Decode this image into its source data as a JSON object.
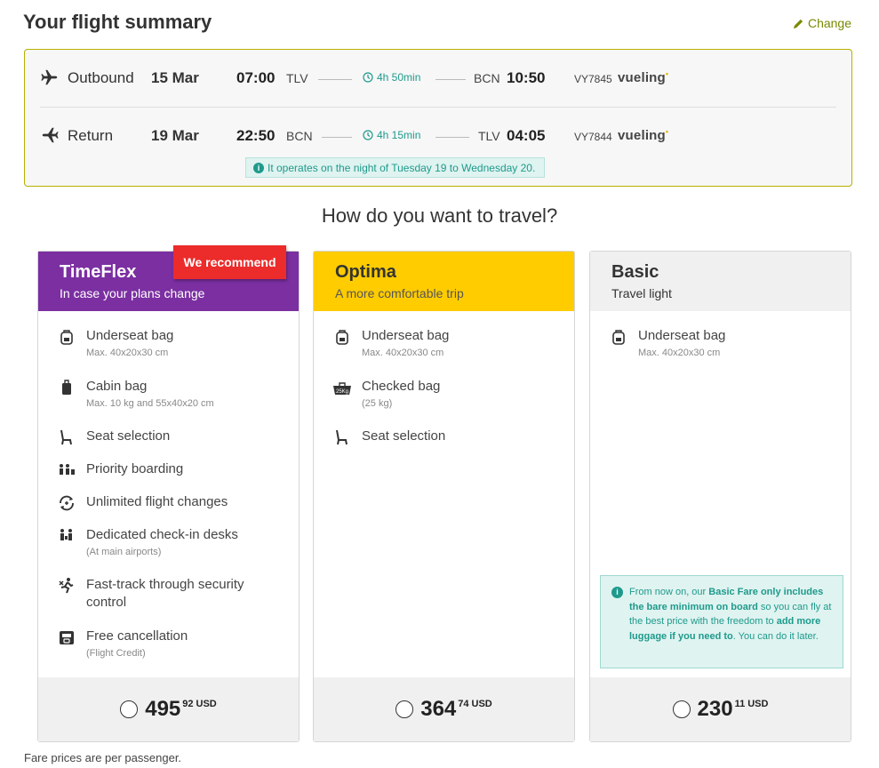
{
  "header": {
    "title": "Your flight summary",
    "change_label": "Change"
  },
  "flights": {
    "outbound": {
      "direction": "Outbound",
      "date": "15 Mar",
      "depart_time": "07:00",
      "depart_code": "TLV",
      "duration": "4h 50min",
      "arrive_code": "BCN",
      "arrive_time": "10:50",
      "flight_no": "VY7845",
      "airline": "vueling"
    },
    "return": {
      "direction": "Return",
      "date": "19 Mar",
      "depart_time": "22:50",
      "depart_code": "BCN",
      "duration": "4h 15min",
      "arrive_code": "TLV",
      "arrive_time": "04:05",
      "flight_no": "VY7844",
      "airline": "vueling"
    },
    "night_note": "It operates on the night of Tuesday 19 to Wednesday 20."
  },
  "question": "How do you want to travel?",
  "fares": [
    {
      "name": "TimeFlex",
      "subtitle": "In case your plans change",
      "badge": "We recommend",
      "features": [
        {
          "icon": "backpack-icon",
          "label": "Underseat bag",
          "detail": "Max. 40x20x30 cm"
        },
        {
          "icon": "suitcase-icon",
          "label": "Cabin bag",
          "detail": "Max. 10 kg and 55x40x20 cm"
        },
        {
          "icon": "seat-icon",
          "label": "Seat selection",
          "detail": ""
        },
        {
          "icon": "priority-boarding-icon",
          "label": "Priority boarding",
          "detail": ""
        },
        {
          "icon": "flight-changes-icon",
          "label": "Unlimited flight changes",
          "detail": ""
        },
        {
          "icon": "check-in-desk-icon",
          "label": "Dedicated check-in desks",
          "detail": "(At main airports)"
        },
        {
          "icon": "fast-track-icon",
          "label": "Fast-track through security control",
          "detail": ""
        },
        {
          "icon": "cancellation-icon",
          "label": "Free cancellation",
          "detail": "(Flight Credit)"
        }
      ],
      "price_int": "495",
      "price_dec": "92",
      "currency": "USD"
    },
    {
      "name": "Optima",
      "subtitle": "A more comfortable trip",
      "features": [
        {
          "icon": "backpack-icon",
          "label": "Underseat bag",
          "detail": "Max. 40x20x30 cm"
        },
        {
          "icon": "checked-bag-icon",
          "label": "Checked bag",
          "detail": "(25 kg)",
          "tag": "25Kg"
        },
        {
          "icon": "seat-icon",
          "label": "Seat selection",
          "detail": ""
        }
      ],
      "price_int": "364",
      "price_dec": "74",
      "currency": "USD"
    },
    {
      "name": "Basic",
      "subtitle": "Travel light",
      "features": [
        {
          "icon": "backpack-icon",
          "label": "Underseat bag",
          "detail": "Max. 40x20x30 cm"
        }
      ],
      "info": {
        "t1": "From now on, our ",
        "b1": "Basic Fare only includes the bare minimum on board",
        "t2": " so you can fly at the best price with the freedom to ",
        "b2": "add more luggage if you need to",
        "t3": ". You can do it later."
      },
      "price_int": "230",
      "price_dec": "11",
      "currency": "USD"
    }
  ],
  "disclaimer": "Fare prices are per passenger.",
  "colors": {
    "timeflex": "#7b2fa1",
    "optima": "#ffcc00",
    "basic": "#f0f0f0",
    "badge": "#ec2b2b",
    "accent": "#1e9a8c",
    "summary_border": "#b7b000"
  }
}
